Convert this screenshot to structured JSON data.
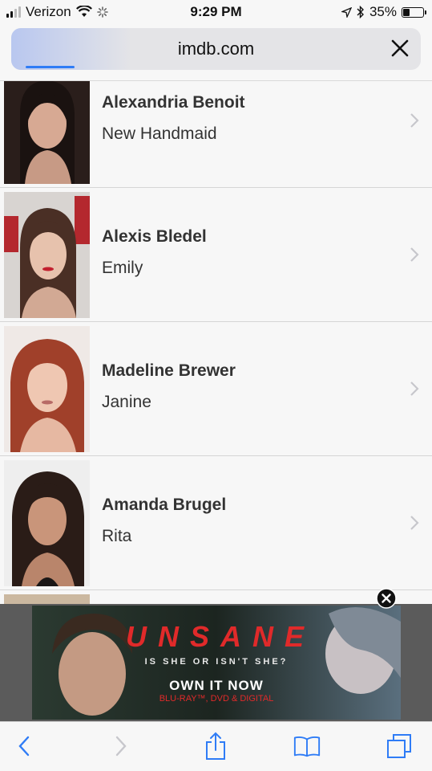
{
  "status_bar": {
    "carrier": "Verizon",
    "time": "9:29 PM",
    "battery_percent": "35%",
    "battery_level": 0.35
  },
  "browser": {
    "url": "imdb.com",
    "load_progress": 0.12
  },
  "cast": [
    {
      "name": "Alexandria Benoit",
      "role": "New Handmaid"
    },
    {
      "name": "Alexis Bledel",
      "role": "Emily"
    },
    {
      "name": "Madeline Brewer",
      "role": "Janine"
    },
    {
      "name": "Amanda Brugel",
      "role": "Rita"
    }
  ],
  "ad": {
    "title": "UNSANE",
    "tagline": "IS SHE OR ISN'T SHE?",
    "cta": "OWN IT NOW",
    "formats": "BLU-RAY™, DVD & DIGITAL"
  },
  "colors": {
    "accent_blue": "#2f7cf6",
    "ad_red": "#e02a2a"
  },
  "icons": {
    "back": "chevron-left-icon",
    "forward": "chevron-right-icon",
    "share": "share-icon",
    "bookmarks": "book-icon",
    "tabs": "tabs-icon"
  }
}
